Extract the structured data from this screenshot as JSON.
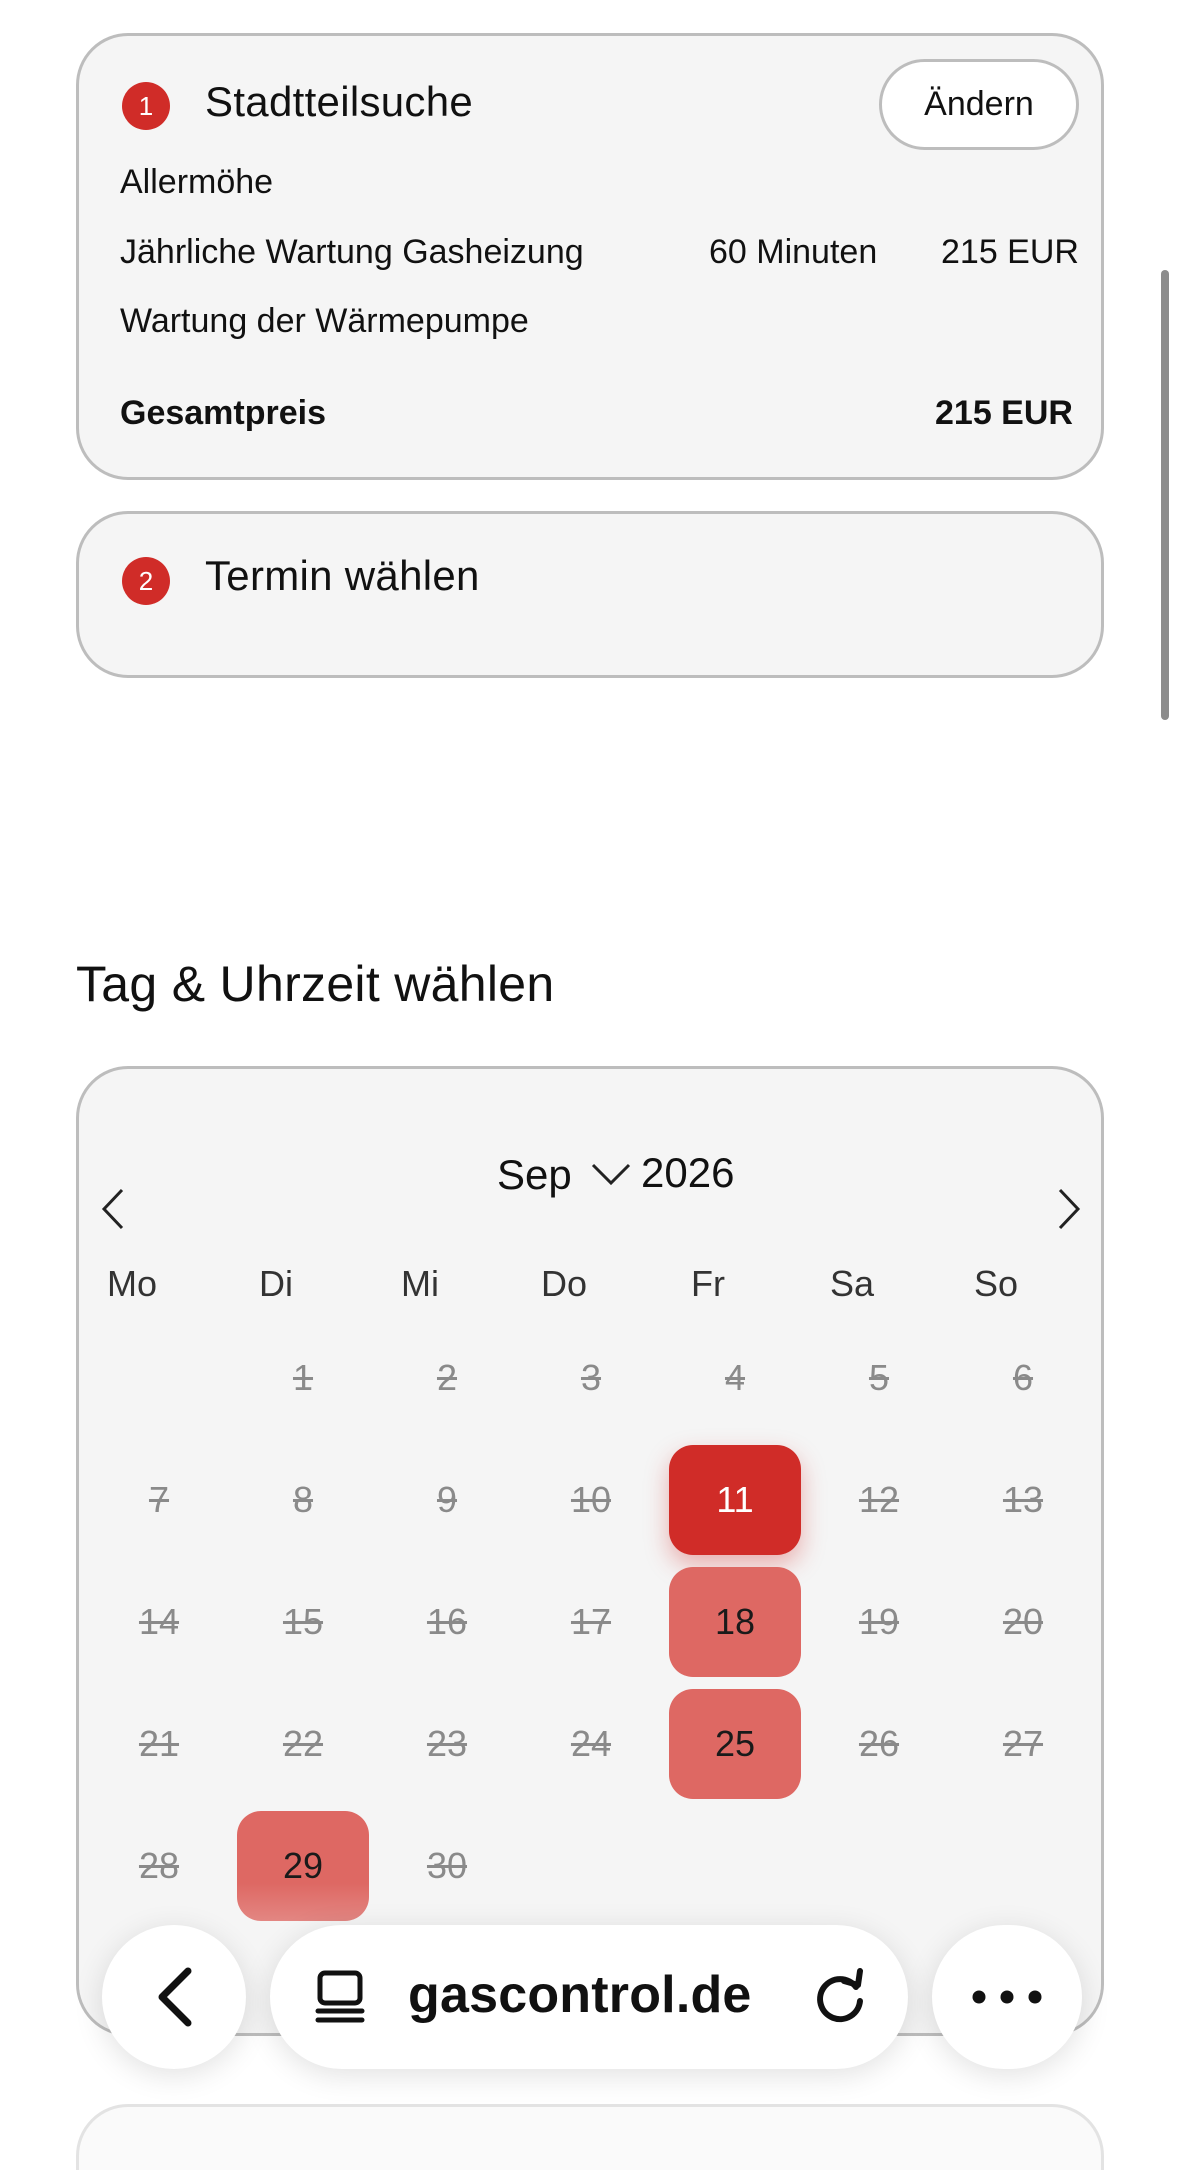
{
  "step1": {
    "badge": "1",
    "title": "Stadtteilsuche",
    "change_label": "Ändern",
    "district": "Allermöhe",
    "service1": {
      "name": "Jährliche Wartung Gasheizung",
      "duration": "60 Minuten",
      "price": "215 EUR"
    },
    "service2": {
      "name": "Wartung der Wärmepumpe"
    },
    "total_label": "Gesamtpreis",
    "total_value": "215 EUR"
  },
  "step2": {
    "badge": "2",
    "title": "Termin wählen"
  },
  "section_title": "Tag & Uhrzeit wählen",
  "calendar": {
    "month": "Sep",
    "year": "2026",
    "weekdays": [
      "Mo",
      "Di",
      "Mi",
      "Do",
      "Fr",
      "Sa",
      "So"
    ],
    "first_weekday_index": 1,
    "days_in_month": 30,
    "available_days": [
      11,
      18,
      25,
      29
    ],
    "selected_day": 11,
    "colors": {
      "selected": "#d02c28",
      "available": "#de6863",
      "disabled_text": "#8a8a8a"
    }
  },
  "browser": {
    "url": "gascontrol.de"
  },
  "icons": {
    "back": "chevron-left-icon",
    "tabs": "tabs-icon",
    "reload": "reload-icon",
    "more": "more-dots-icon"
  }
}
